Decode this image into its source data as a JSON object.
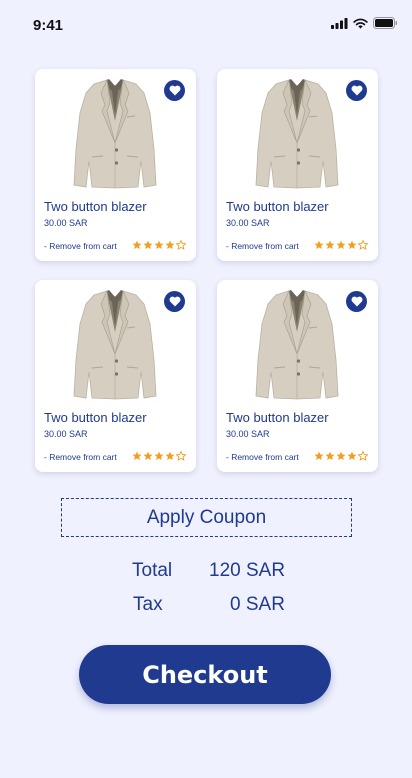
{
  "status_bar": {
    "time": "9:41"
  },
  "products": [
    {
      "title": "Two button blazer",
      "price": "30.00 SAR",
      "remove_label": "- Remove from cart",
      "rating": 4,
      "rating_max": 5
    },
    {
      "title": "Two button blazer",
      "price": "30.00 SAR",
      "remove_label": "- Remove from cart",
      "rating": 4,
      "rating_max": 5
    },
    {
      "title": "Two button blazer",
      "price": "30.00 SAR",
      "remove_label": "- Remove from cart",
      "rating": 4,
      "rating_max": 5
    },
    {
      "title": "Two button blazer",
      "price": "30.00 SAR",
      "remove_label": "- Remove from cart",
      "rating": 4,
      "rating_max": 5
    }
  ],
  "coupon": {
    "label": "Apply Coupon"
  },
  "summary": {
    "total_label": "Total",
    "total_value": "120 SAR",
    "tax_label": "Tax",
    "tax_value": "0 SAR"
  },
  "checkout": {
    "label": "Checkout"
  },
  "colors": {
    "accent": "#1f3a8f",
    "background": "#f0f1fe",
    "star": "#f0a020"
  },
  "icons": {
    "favorite": "heart-icon",
    "rating": "star-icon",
    "signal": "cellular-signal-icon",
    "wifi": "wifi-icon",
    "battery": "battery-icon"
  }
}
